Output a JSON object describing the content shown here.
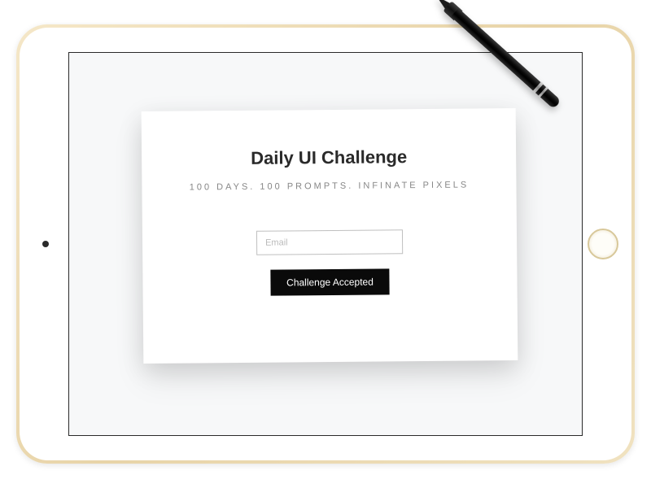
{
  "card": {
    "title": "Daily UI Challenge",
    "subtitle": "100 DAYS. 100 PROMPTS. INFINATE PIXELS",
    "email_placeholder": "Email",
    "button_label": "Challenge Accepted"
  }
}
